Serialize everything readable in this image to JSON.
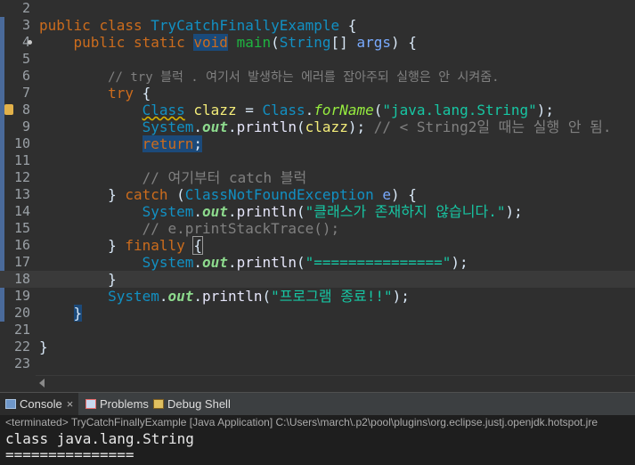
{
  "editor": {
    "lines": [
      {
        "n": "2"
      },
      {
        "n": "3"
      },
      {
        "n": "4"
      },
      {
        "n": "5"
      },
      {
        "n": "6"
      },
      {
        "n": "7"
      },
      {
        "n": "8"
      },
      {
        "n": "9"
      },
      {
        "n": "10"
      },
      {
        "n": "11"
      },
      {
        "n": "12"
      },
      {
        "n": "13"
      },
      {
        "n": "14"
      },
      {
        "n": "15"
      },
      {
        "n": "16"
      },
      {
        "n": "17"
      },
      {
        "n": "18"
      },
      {
        "n": "19"
      },
      {
        "n": "20"
      },
      {
        "n": "21"
      },
      {
        "n": "22"
      },
      {
        "n": "23"
      }
    ],
    "tokens": {
      "public": "public",
      "class": "class",
      "class_name": "TryCatchFinallyExample",
      "brace_open": " {",
      "static": "static",
      "void": "void",
      "main": "main",
      "string_type": "String",
      "array_args_open": "[] ",
      "args": "args",
      "paren_close_brace": ") {",
      "comment_try": "// try 블럭 . 여기서 발생하는 에러를 잡아주되 실행은 안 시켜줌.",
      "try": "try",
      "Class_type": "Class",
      "clazz": "clazz",
      "assign": " = ",
      "Class_ref": "Class",
      "dot": ".",
      "forName": "forName",
      "str_java_lang": "\"java.lang.String\"",
      "close_semi": ");",
      "System": "System",
      "out": "out",
      "println": "println",
      "open_paren": "(",
      "clazz_arg": "clazz",
      "comment_string2": "// < String2일 때는 실행 안 됨.",
      "return": "return",
      "semi": ";",
      "comment_catch": "// 여기부터 catch 블럭",
      "catch": "catch",
      "exception_type": "ClassNotFoundException",
      "e_param": "e",
      "str_korean_class": "\"클래스가 존재하지 않습니다.\"",
      "comment_stack": "// e.printStackTrace();",
      "finally": "finally",
      "str_equals": "\"===============\"",
      "str_program_end": "\"프로그램 종료!!\"",
      "close_brace": "}",
      "lbrace": "{"
    }
  },
  "console": {
    "tabs": [
      {
        "label": "Console",
        "close": "×"
      },
      {
        "label": "Problems"
      },
      {
        "label": "Debug Shell"
      }
    ],
    "status": "<terminated> TryCatchFinallyExample [Java Application] C:\\Users\\march\\.p2\\pool\\plugins\\org.eclipse.justj.openjdk.hotspot.jre",
    "output": [
      "class java.lang.String",
      "==============="
    ]
  },
  "colors": {
    "editor_bg": "#2f2f2f",
    "keyword": "#cc6c1d",
    "class": "#1290c3",
    "method": "#1eb540",
    "string": "#17c6a3",
    "comment": "#808080"
  }
}
